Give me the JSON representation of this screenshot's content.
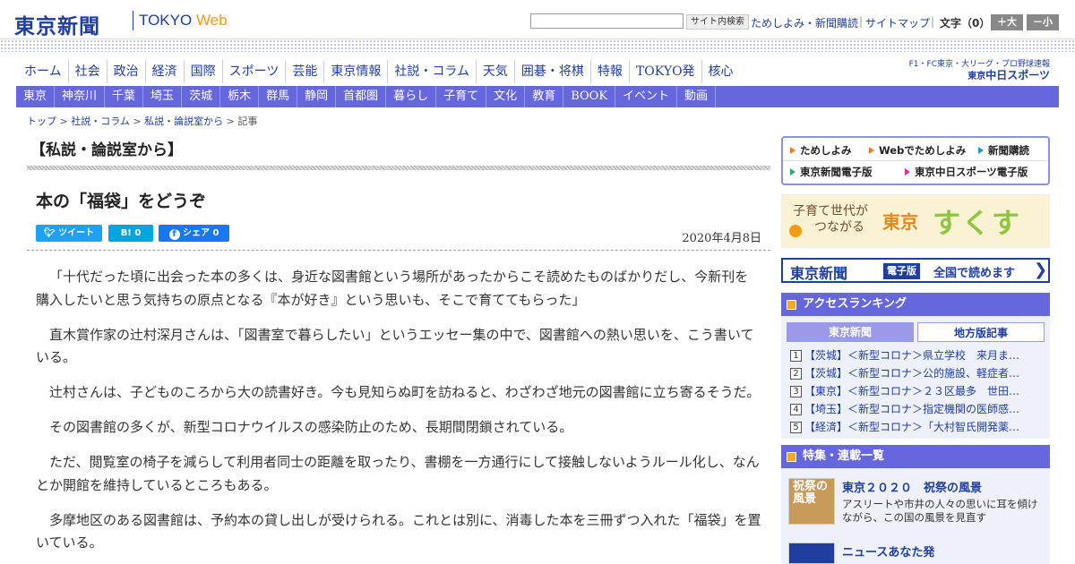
{
  "header": {
    "logo_ja": "東京新聞",
    "logo_en": "TOKYO",
    "logo_web": "Web",
    "search_placeholder": "",
    "search_button": "サイト内検索",
    "link_subscribe": "ためしよみ・新聞購読",
    "link_sitemap": "サイトマップ",
    "font_label": "文字（0）",
    "font_larger": "＋大",
    "font_smaller": "－小"
  },
  "main_nav": [
    "ホーム",
    "社会",
    "政治",
    "経済",
    "国際",
    "スポーツ",
    "芸能",
    "東京情報",
    "社説・コラム",
    "天気",
    "囲碁・将棋",
    "特報",
    "TOKYO発",
    "核心"
  ],
  "sports_banner": {
    "line1": "F1・FC東京・大リーグ・プロ野球速報",
    "line2_prefix": "東京",
    "line2_main": "中日スポーツ"
  },
  "sub_nav": [
    "東京",
    "神奈川",
    "千葉",
    "埼玉",
    "茨城",
    "栃木",
    "群馬",
    "静岡",
    "首都圏",
    "暮らし",
    "子育て",
    "文化",
    "教育",
    "BOOK",
    "イベント",
    "動画"
  ],
  "breadcrumb": {
    "items": [
      "トップ",
      "社説・コラム",
      "私説・論説室から"
    ],
    "current": "記事",
    "separator": " > "
  },
  "article": {
    "section": "【私説・論説室から】",
    "title": "本の「福袋」をどうぞ",
    "date": "2020年4月8日",
    "share": {
      "tweet": "ツイート",
      "hatena": "B! 0",
      "facebook": "シェア 0"
    },
    "paragraphs": [
      "「十代だった頃に出会った本の多くは、身近な図書館という場所があったからこそ読めたものばかりだし、今新刊を購入したいと思う気持ちの原点となる『本が好き』という思いも、そこで育ててもらった」",
      "直木賞作家の辻村深月さんは、「図書室で暮らしたい」というエッセー集の中で、図書館への熱い思いを、こう書いている。",
      "辻村さんは、子どものころから大の読書好き。今も見知らぬ町を訪ねると、わざわざ地元の図書館に立ち寄るそうだ。",
      "その図書館の多くが、新型コロナウイルスの感染防止のため、長期間閉鎖されている。",
      "ただ、閲覧室の椅子を減らして利用者同士の距離を取ったり、書棚を一方通行にして接触しないようルール化し、なんとか開館を維持しているところもある。",
      "多摩地区のある図書館は、予約本の貸し出しが受けられる。これとは別に、消毒した本を三冊ずつ入れた「福袋」を置いている。"
    ]
  },
  "sidebar": {
    "quick_links": [
      "ためしよみ",
      "Webでためしよみ",
      "新聞購読",
      "東京新聞電子版",
      "東京中日スポーツ電子版"
    ],
    "sukusuku": {
      "sub_line1": "子育て世代が",
      "sub_line2": "つながる",
      "city": "東京",
      "main": "すくすく"
    },
    "denshiban": {
      "logo": "東京新聞",
      "tag": "電子版",
      "text": "全国で読めます",
      "arrow": "❯"
    },
    "ranking": {
      "title": "アクセスランキング",
      "tab_active": "東京新聞",
      "tab_inactive": "地方版記事",
      "items": [
        {
          "num": "1",
          "text": "【茨城】＜新型コロナ＞県立学校　来月ま…"
        },
        {
          "num": "2",
          "text": "【茨城】＜新型コロナ＞公的施設、軽症者…"
        },
        {
          "num": "3",
          "text": "【東京】＜新型コロナ＞２３区最多　世田…"
        },
        {
          "num": "4",
          "text": "【埼玉】＜新型コロナ＞指定機関の医師感…"
        },
        {
          "num": "5",
          "text": "【経済】＜新型コロナ＞「大村智氏開発薬…"
        }
      ]
    },
    "features": {
      "title": "特集・連載一覧",
      "item1_thumb": "祝祭の風景",
      "item1_title": "東京２０２０　祝祭の風景",
      "item1_desc": "アスリートや市井の人々の思いに耳を傾けながら、この国の風景を見直す",
      "item2_title": "ニュースあなた発"
    }
  }
}
